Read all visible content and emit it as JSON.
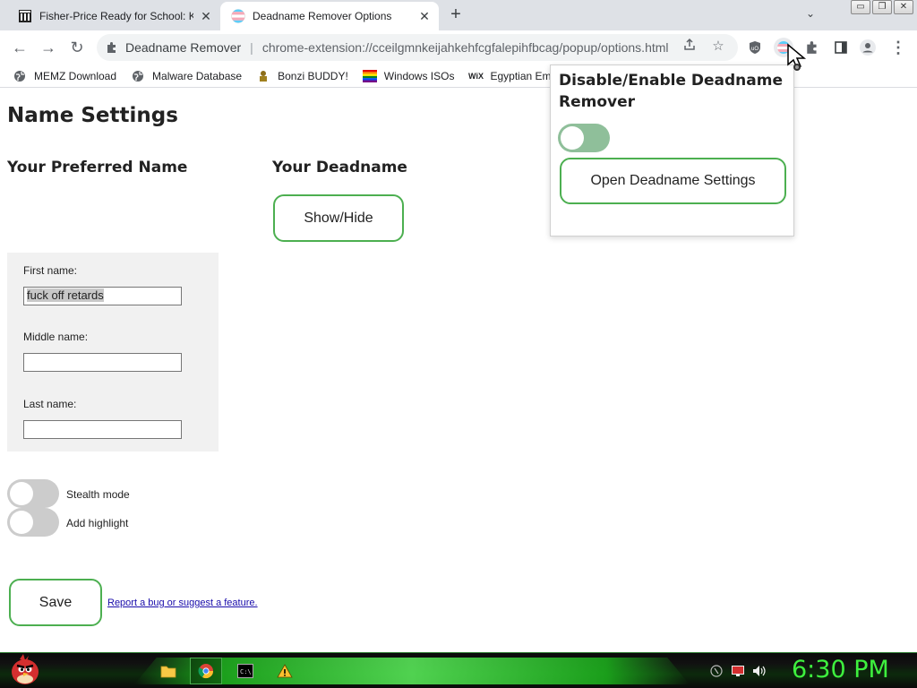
{
  "tabs": [
    {
      "title": "Fisher-Price Ready for School: Ki",
      "close": "✕"
    },
    {
      "title": "Deadname Remover Options",
      "close": "✕"
    }
  ],
  "new_tab": "+",
  "tab_menu": "⌄",
  "window_buttons": [
    "▭",
    "❐",
    "✕"
  ],
  "toolbar": {
    "back": "←",
    "forward": "→",
    "reload": "↻",
    "extension_chip": "Deadname Remover",
    "url": "chrome-extension://cceilgmnkeijahkehfcgfalepihfbcag/popup/options.html",
    "menu": "⋮"
  },
  "bookmarks": [
    {
      "label": "MEMZ Download",
      "icon": "globe-icon"
    },
    {
      "label": "Malware Database",
      "icon": "globe-icon"
    },
    {
      "label": "Bonzi BUDDY!",
      "icon": "bonzi-icon"
    },
    {
      "label": "Windows ISOs",
      "icon": "rainbow-flag-icon"
    },
    {
      "label": "Egyptian Emba",
      "icon": "wix-icon"
    }
  ],
  "page": {
    "title": "Name Settings",
    "preferred_heading": "Your Preferred Name",
    "deadname_heading": "Your Deadname",
    "show_hide": "Show/Hide",
    "first_label": "First name:",
    "first_value": "fuck off retards",
    "middle_label": "Middle name:",
    "middle_value": "",
    "last_label": "Last name:",
    "last_value": "",
    "stealth_label": "Stealth mode",
    "highlight_label": "Add highlight",
    "save": "Save",
    "report_link": "Report a bug or suggest a feature."
  },
  "popup": {
    "title": "Disable/Enable Deadname Remover",
    "open_settings": "Open Deadname Settings"
  },
  "taskbar": {
    "clock": "6:30 PM"
  },
  "colors": {
    "accent_green": "#4caf50",
    "clock_green": "#3ef03e"
  }
}
